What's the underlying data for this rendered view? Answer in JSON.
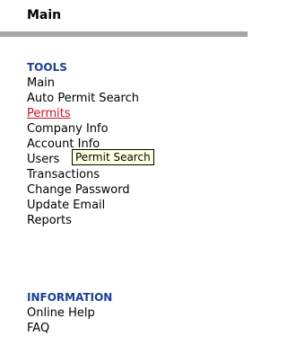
{
  "header": {
    "title": "Main"
  },
  "tools": {
    "heading": "TOOLS",
    "items": [
      {
        "label": "Main"
      },
      {
        "label": "Auto Permit Search"
      },
      {
        "label": "Permits",
        "active": true
      },
      {
        "label": "Company Info"
      },
      {
        "label": "Account Info"
      },
      {
        "label": "Users"
      },
      {
        "label": "Transactions"
      },
      {
        "label": "Change Password"
      },
      {
        "label": "Update Email"
      },
      {
        "label": "Reports"
      }
    ]
  },
  "information": {
    "heading": "INFORMATION",
    "items": [
      {
        "label": "Online Help"
      },
      {
        "label": "FAQ"
      }
    ]
  },
  "tooltip": {
    "text": "Permit Search"
  },
  "colors": {
    "heading": "#1c3f94",
    "active_link": "#c8102e",
    "rule": "#a6a6a6",
    "tooltip_bg": "#ffffe1"
  }
}
